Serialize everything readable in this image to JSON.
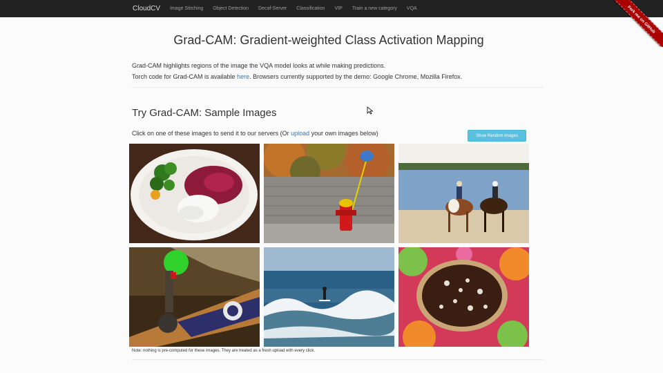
{
  "navbar": {
    "brand": "CloudCV",
    "links": [
      "Image Stitching",
      "Object Detection",
      "Decaf-Server",
      "Classification",
      "VIP",
      "Train a new category",
      "VQA"
    ],
    "ribbon": "Fork me on GitHub"
  },
  "header": {
    "title": "Grad-CAM: Gradient-weighted Class Activation Mapping"
  },
  "intro": {
    "line1": "Grad-CAM highlights regions of the image the VQA model looks at while making predictions.",
    "line2_prefix": "Torch code for Grad-CAM is available ",
    "line2_link": "here",
    "line2_suffix": ". Browsers currently supported by the demo: Google Chrome, Mozilla Firefox."
  },
  "samples": {
    "title": "Try Grad-CAM: Sample Images",
    "instructions_prefix": "Click on one of these images to send it to our servers (Or ",
    "instructions_link": "upload",
    "instructions_suffix": " your own images below)",
    "random_button": "Show Random Images",
    "images": [
      {
        "name": "food-plate-image"
      },
      {
        "name": "fire-hydrant-image"
      },
      {
        "name": "horses-beach-image"
      },
      {
        "name": "skateboard-image"
      },
      {
        "name": "surfer-image"
      },
      {
        "name": "pizza-image"
      }
    ],
    "note": "Note: nothing is pre-computed for these images. They are treated as a fresh upload with every click."
  },
  "colors": {
    "navbar_bg": "#222222",
    "link": "#337ab7",
    "button": "#5bc0de",
    "ribbon": "#aa0000"
  }
}
